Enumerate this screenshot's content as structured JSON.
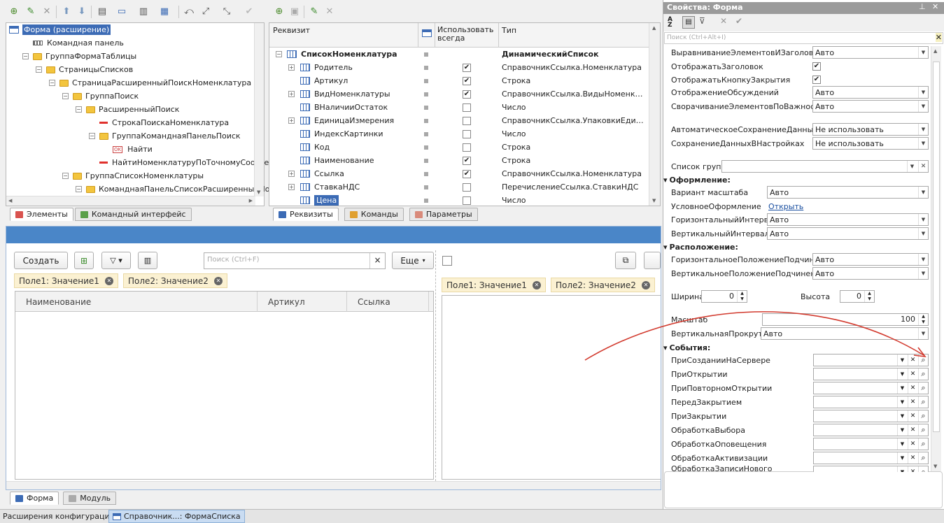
{
  "tree": {
    "items": [
      {
        "label": "Форма (расширение)",
        "level": 0
      },
      {
        "label": "Командная панель",
        "level": 1
      },
      {
        "label": "ГруппаФормаТаблицы",
        "level": 1
      },
      {
        "label": "СтраницыСписков",
        "level": 2
      },
      {
        "label": "СтраницаРасширенныйПоискНоменклатура",
        "level": 3
      },
      {
        "label": "ГруппаПоиск",
        "level": 4
      },
      {
        "label": "РасширенныйПоиск",
        "level": 5
      },
      {
        "label": "СтрокаПоискаНоменклатура",
        "level": 6
      },
      {
        "label": "ГруппаКоманднаяПанельПоиск",
        "level": 6
      },
      {
        "label": "Найти",
        "level": 7
      },
      {
        "label": "НайтиНоменклатуруПоТочномуСоответствию",
        "level": 6
      },
      {
        "label": "ГруппаСписокНоменклатуры",
        "level": 4
      },
      {
        "label": "КоманднаяПанельСписокРасширенныйПоиск",
        "level": 5
      }
    ],
    "tabs": [
      "Элементы",
      "Командный интерфейс"
    ]
  },
  "attrs": {
    "headers": [
      "Реквизит",
      "Использовать всегда",
      "Тип"
    ],
    "rows": [
      {
        "name": "СписокНоменклатура",
        "check": "",
        "type": "ДинамическийСписок"
      },
      {
        "name": "Родитель",
        "check": "✔",
        "type": "СправочникСсылка.Номенклатура"
      },
      {
        "name": "Артикул",
        "check": "✔",
        "type": "Строка"
      },
      {
        "name": "ВидНоменклатуры",
        "check": "✔",
        "type": "СправочникСсылка.ВидыНоменклатуры"
      },
      {
        "name": "ВНаличииОстаток",
        "check": "",
        "type": "Число"
      },
      {
        "name": "ЕдиницаИзмерения",
        "check": "",
        "type": "СправочникСсылка.УпаковкиЕдиницыИзмерения"
      },
      {
        "name": "ИндексКартинки",
        "check": "",
        "type": "Число"
      },
      {
        "name": "Код",
        "check": "",
        "type": "Строка"
      },
      {
        "name": "Наименование",
        "check": "✔",
        "type": "Строка"
      },
      {
        "name": "Ссылка",
        "check": "✔",
        "type": "СправочникСсылка.Номенклатура"
      },
      {
        "name": "СтавкаНДС",
        "check": "",
        "type": "ПеречислениеСсылка.СтавкиНДС"
      },
      {
        "name": "Цена",
        "check": "",
        "type": "Число"
      }
    ],
    "tabs": [
      "Реквизиты",
      "Команды",
      "Параметры"
    ]
  },
  "preview": {
    "create": "Создать",
    "search_placeholder": "Поиск (Ctrl+F)",
    "search_clear": "×",
    "more": "Еще",
    "chips_left": [
      "Поле1: Значение1",
      "Поле2: Значение2"
    ],
    "chips_right": [
      "Поле1: Значение1",
      "Поле2: Значение2"
    ],
    "columns": [
      "Наименование",
      "Артикул",
      "Ссылка"
    ],
    "tabs": [
      "Форма",
      "Модуль"
    ]
  },
  "props": {
    "title": "Свойства: Форма",
    "search_placeholder": "Поиск (Ctrl+Alt+I)",
    "rows": [
      {
        "label": "ВыравниваниеЭлементовИЗаголовков",
        "value": "Авто"
      },
      {
        "label": "ОтображатьЗаголовок",
        "value": "✔"
      },
      {
        "label": "ОтображатьКнопкуЗакрытия",
        "value": "✔"
      },
      {
        "label": "ОтображениеОбсуждений",
        "value": "Авто"
      },
      {
        "label": "СворачиваниеЭлементовПоВажности",
        "value": "Авто"
      },
      {
        "label": "АвтоматическоеСохранениеДанныхВНастройках",
        "value": "Не использовать"
      },
      {
        "label": "СохранениеДанныхВНастройках",
        "value": "Не использовать"
      },
      {
        "label": "Список групп",
        "value": ""
      }
    ],
    "sect_design": "Оформление:",
    "design": [
      {
        "label": "Вариант масштаба",
        "value": "Авто"
      },
      {
        "label": "УсловноеОформление",
        "value": "Открыть"
      },
      {
        "label": "ГоризонтальныйИнтервал",
        "value": "Авто"
      },
      {
        "label": "ВертикальныйИнтервал",
        "value": "Авто"
      }
    ],
    "sect_layout": "Расположение:",
    "layout": [
      {
        "label": "ГоризонтальноеПоложениеПодчиненных",
        "value": "Авто"
      },
      {
        "label": "ВертикальноеПоложениеПодчиненных",
        "value": "Авто"
      }
    ],
    "width_label": "Ширина",
    "width_value": "0",
    "height_label": "Высота",
    "height_value": "0",
    "scale_label": "Масштаб",
    "scale_value": "100",
    "vscroll_label": "ВертикальнаяПрокрутка",
    "vscroll_value": "Авто",
    "sect_events": "События:",
    "events": [
      "ПриСозданииНаСервере",
      "ПриОткрытии",
      "ПриПовторномОткрытии",
      "ПередЗакрытием",
      "ПриЗакрытии",
      "ОбработкаВыбора",
      "ОбработкаОповещения",
      "ОбработкаАктивизации",
      "ОбработкаЗаписиНового"
    ]
  },
  "status": {
    "items": [
      "Расширения конфигурации",
      "Справочник...: ФормаСписка"
    ]
  },
  "colors": {
    "accent": "#4a86c8",
    "arrow": "#d23a2e"
  }
}
